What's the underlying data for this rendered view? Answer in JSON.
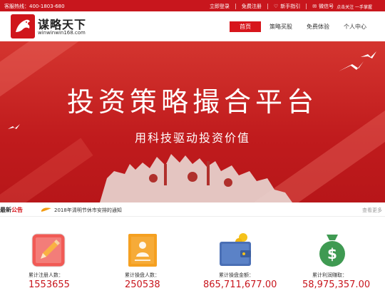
{
  "topbar": {
    "hotline": "客服热线：400-1803-680",
    "login": "立即登录",
    "register": "免费注册",
    "guide": "新手指引",
    "wechat": "微信号",
    "follow": "点击关注 一手掌握"
  },
  "header": {
    "logo_name": "谋略天下",
    "logo_domain": "winwinwin168.com",
    "nav": [
      "首页",
      "策略买股",
      "免费体验",
      "个人中心"
    ]
  },
  "banner": {
    "title": "投资策略撮合平台",
    "subtitle": "用科技驱动投资价值"
  },
  "notice": {
    "label_a": "最新",
    "label_b": "公告",
    "text": "2018年清明节休市安排的通知",
    "more": "查看更多"
  },
  "stats": [
    {
      "caption": "累计注册人数：",
      "value": "1553655",
      "icon": "pencil-icon"
    },
    {
      "caption": "累计操盘人数：",
      "value": "250538",
      "icon": "trader-icon"
    },
    {
      "caption": "累计操盘金额：",
      "value": "865,711,677.00",
      "icon": "wallet-icon"
    },
    {
      "caption": "累计利润赚取：",
      "value": "58,975,357.00",
      "icon": "money-bag-icon"
    }
  ],
  "colors": {
    "brand_red": "#c8161d",
    "orange": "#f5a021",
    "green": "#3f9a52",
    "blue": "#4a6fb5"
  }
}
